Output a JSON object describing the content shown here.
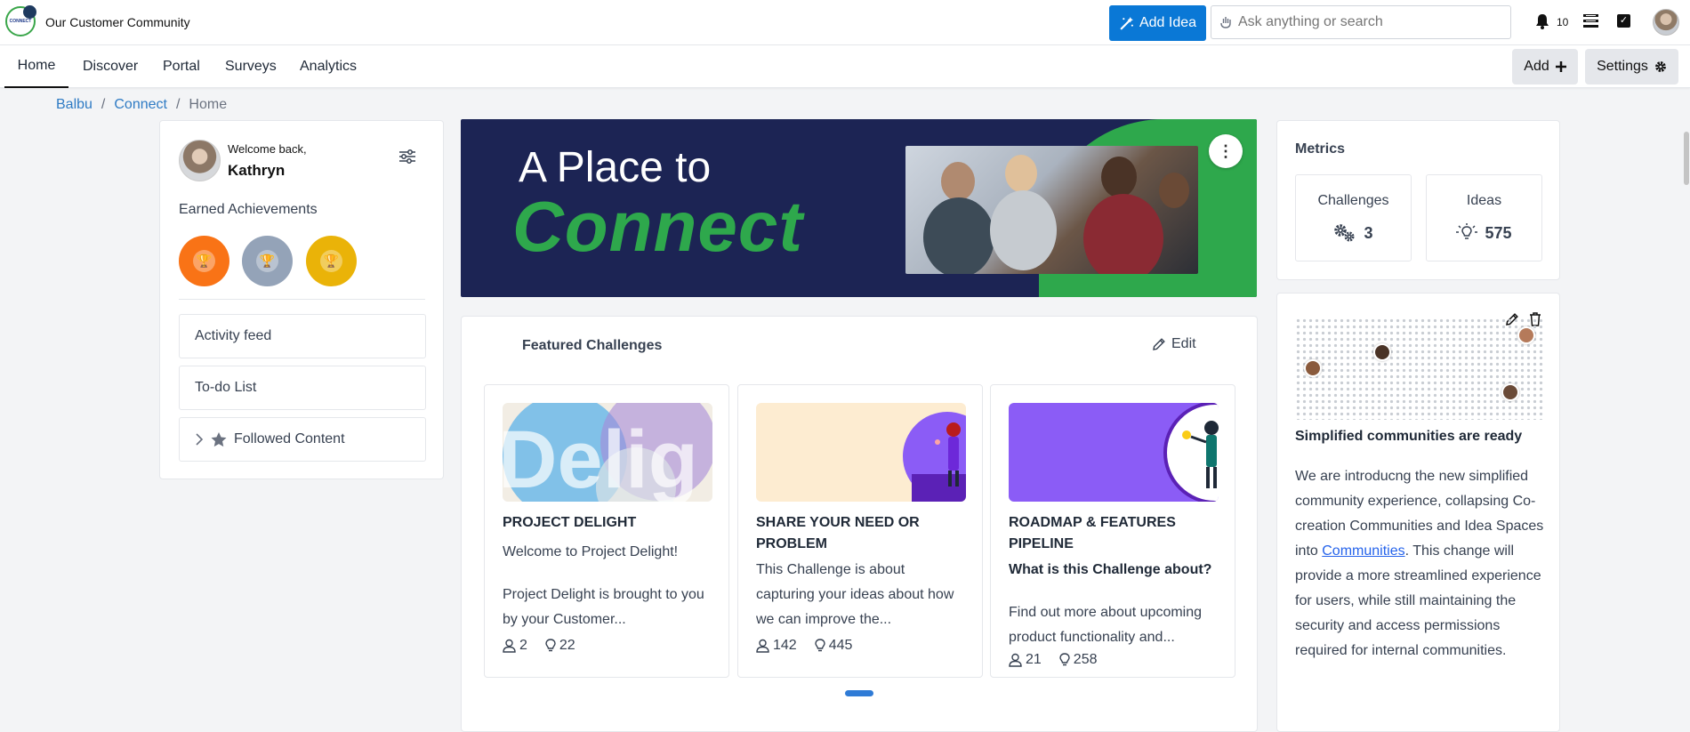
{
  "header": {
    "logo_text": "CONNECT",
    "app_title": "Our Customer Community",
    "add_idea_label": "Add Idea",
    "search_placeholder": "Ask anything or search",
    "notification_count": "10"
  },
  "nav": {
    "tabs": [
      {
        "label": "Home",
        "active": true
      },
      {
        "label": "Discover"
      },
      {
        "label": "Portal"
      },
      {
        "label": "Surveys"
      },
      {
        "label": "Analytics"
      }
    ],
    "add_label": "Add",
    "settings_label": "Settings"
  },
  "breadcrumb": [
    "Balbu",
    "Connect",
    "Home"
  ],
  "profile": {
    "welcome": "Welcome back,",
    "name": "Kathryn",
    "achievements_title": "Earned Achievements",
    "badges": [
      {
        "color": "#f97316"
      },
      {
        "color": "#94a3b8"
      },
      {
        "color": "#eab308"
      }
    ],
    "links": [
      "Activity feed",
      "To-do List",
      "Followed Content"
    ]
  },
  "hero": {
    "line1": "A Place to",
    "line2": "Connect"
  },
  "featured": {
    "title": "Featured Challenges",
    "edit_label": "Edit",
    "challenges": [
      {
        "title": "PROJECT DELIGHT",
        "subtitle": "Welcome to Project Delight!",
        "text": "Project Delight is brought to you by your Customer...",
        "members": "2",
        "ideas": "22"
      },
      {
        "title": "SHARE YOUR NEED OR PROBLEM",
        "text": "This Challenge is about capturing your ideas about how we can improve the...",
        "members": "142",
        "ideas": "445"
      },
      {
        "title": "ROADMAP & FEATURES PIPELINE",
        "subtitle": "What is this Challenge about?",
        "text": "Find out more about upcoming product functionality and...",
        "members": "21",
        "ideas": "258"
      }
    ]
  },
  "metrics": {
    "title": "Metrics",
    "challenges_label": "Challenges",
    "challenges_value": "3",
    "ideas_label": "Ideas",
    "ideas_value": "575"
  },
  "news": {
    "title": "Simplified communities are ready",
    "body_before": "We are introducng the new simplified community experience, collapsing Co-creation Communities and Idea Spaces into ",
    "link": "Communities",
    "body_after": ". This change will provide a more streamlined experience for users, while still maintaining the security and access permissions required for internal communities."
  }
}
